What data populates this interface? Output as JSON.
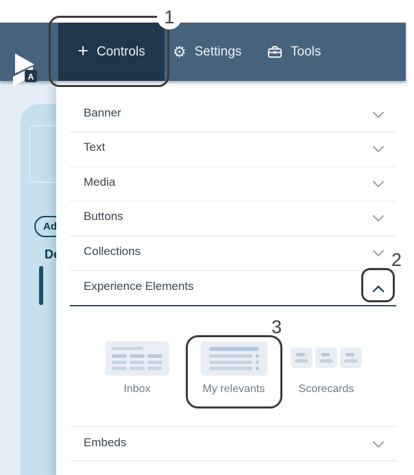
{
  "annotations": {
    "one": "1",
    "two": "2",
    "three": "3"
  },
  "header": {
    "logo_badge": "A",
    "tabs": [
      {
        "label": "Controls",
        "icon": "plus-icon",
        "active": true
      },
      {
        "label": "Settings",
        "icon": "gear-icon",
        "active": false
      },
      {
        "label": "Tools",
        "icon": "toolbox-icon",
        "active": false
      }
    ]
  },
  "panel": {
    "sections": [
      {
        "label": "Banner",
        "state": "collapsed"
      },
      {
        "label": "Text",
        "state": "collapsed"
      },
      {
        "label": "Media",
        "state": "collapsed"
      },
      {
        "label": "Buttons",
        "state": "collapsed"
      },
      {
        "label": "Collections",
        "state": "collapsed"
      },
      {
        "label": "Experience Elements",
        "state": "expanded"
      },
      {
        "label": "Embeds",
        "state": "collapsed"
      }
    ],
    "experience_elements_items": [
      {
        "label": "Inbox"
      },
      {
        "label": "My relevants"
      },
      {
        "label": "Scorecards"
      }
    ]
  },
  "background_page": {
    "add_button_label": "Ad",
    "heading_fragment": "De"
  },
  "colors": {
    "header_bar": "#46627c",
    "active_tab": "#20364a",
    "accent_navy": "#1d4f66",
    "annotation": "#3b3b3b"
  },
  "gear_glyph": "⚙",
  "plus_glyph": "+"
}
